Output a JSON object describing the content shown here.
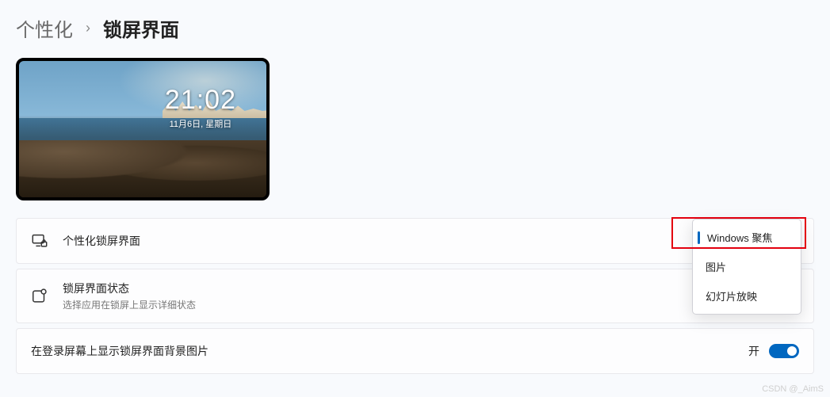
{
  "breadcrumb": {
    "parent": "个性化",
    "separator": "›",
    "current": "锁屏界面"
  },
  "preview": {
    "time": "21:02",
    "date": "11月6日, 星期日"
  },
  "settings": {
    "row1": {
      "title": "个性化锁屏界面"
    },
    "row2": {
      "title": "锁屏界面状态",
      "sub": "选择应用在锁屏上显示详细状态"
    },
    "row3": {
      "title": "在登录屏幕上显示锁屏界面背景图片",
      "toggle_label": "开",
      "toggle_on": true
    }
  },
  "dropdown": {
    "options": [
      {
        "label": "Windows 聚焦",
        "selected": true
      },
      {
        "label": "图片",
        "selected": false
      },
      {
        "label": "幻灯片放映",
        "selected": false
      }
    ]
  },
  "watermark": "CSDN @_AimS"
}
